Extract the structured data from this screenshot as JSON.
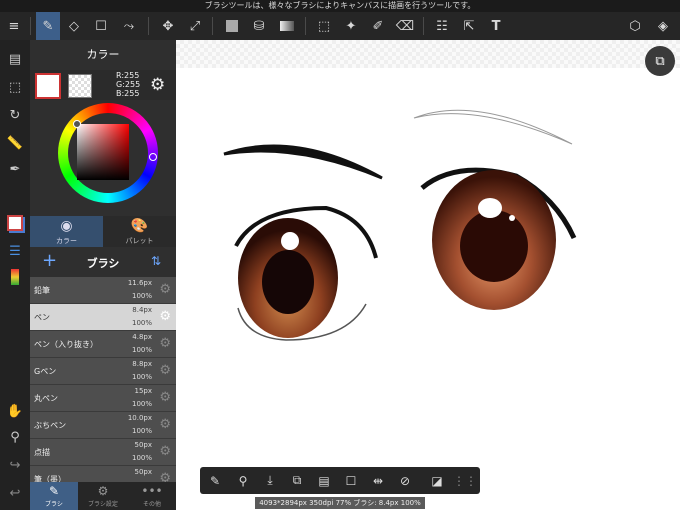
{
  "top_hint": "ブラシツールは、様々なブラシによりキャンバスに描画を行うツールです。",
  "toolbar": {
    "icons": [
      "menu-icon",
      "brush-icon",
      "eraser-icon",
      "rectangle-icon",
      "spline-icon",
      "move-icon",
      "transform-icon",
      "fill-color-icon",
      "bucket-icon",
      "gradient-icon",
      "select-icon",
      "magic-wand-icon",
      "select-pen-icon",
      "select-eraser-icon",
      "frame-icon",
      "operation-icon",
      "text-icon",
      "3d-icon",
      "layers-icon"
    ]
  },
  "left_tools": [
    "layer-list-icon",
    "selection-icon",
    "rotate-icon",
    "ruler-icon",
    "snap-pen-icon",
    "color-icon",
    "brush-list-icon",
    "palette-icon",
    "hand-icon",
    "eyedropper-icon",
    "redo-icon",
    "undo-icon"
  ],
  "panel": {
    "title": "カラー",
    "rgb": {
      "r": "R:255",
      "g": "G:255",
      "b": "B:255"
    },
    "tabs": [
      {
        "label": "カラー",
        "icon": "color-circle-icon",
        "active": true
      },
      {
        "label": "パレット",
        "icon": "palette-icon",
        "active": false
      }
    ],
    "brush_title": "ブラシ"
  },
  "brushes": [
    {
      "name": "鉛筆",
      "size": "11.6px",
      "opacity": "100%"
    },
    {
      "name": "ペン",
      "size": "8.4px",
      "opacity": "100%",
      "selected": true
    },
    {
      "name": "ペン（入り抜き）",
      "size": "4.8px",
      "opacity": "100%"
    },
    {
      "name": "Gペン",
      "size": "8.8px",
      "opacity": "100%"
    },
    {
      "name": "丸ペン",
      "size": "15px",
      "opacity": "100%"
    },
    {
      "name": "ぶちペン",
      "size": "10.0px",
      "opacity": "100%"
    },
    {
      "name": "点描",
      "size": "50px",
      "opacity": "100%"
    },
    {
      "name": "筆（墨）",
      "size": "50px",
      "opacity": ""
    }
  ],
  "bottom_tabs": [
    {
      "label": "ブラシ",
      "icon": "brush-icon",
      "active": true
    },
    {
      "label": "ブラシ設定",
      "icon": "brush-settings-icon",
      "active": false
    },
    {
      "label": "その他",
      "icon": "more-icon",
      "active": false
    }
  ],
  "bottom_toolbar": [
    "stabilizer-icon",
    "eyedropper-icon",
    "import-icon",
    "copy-icon",
    "paste-icon",
    "canvas-icon",
    "flip-icon",
    "snap-off-icon",
    "draft-icon",
    "handle-icon"
  ],
  "status": "4093*2894px 350dpi 77% ブラシ: 8.4px 100%",
  "colors": {
    "accent": "#3d5f8a",
    "iris": "#b55a2c",
    "selected_row": "#d6d6d6"
  }
}
